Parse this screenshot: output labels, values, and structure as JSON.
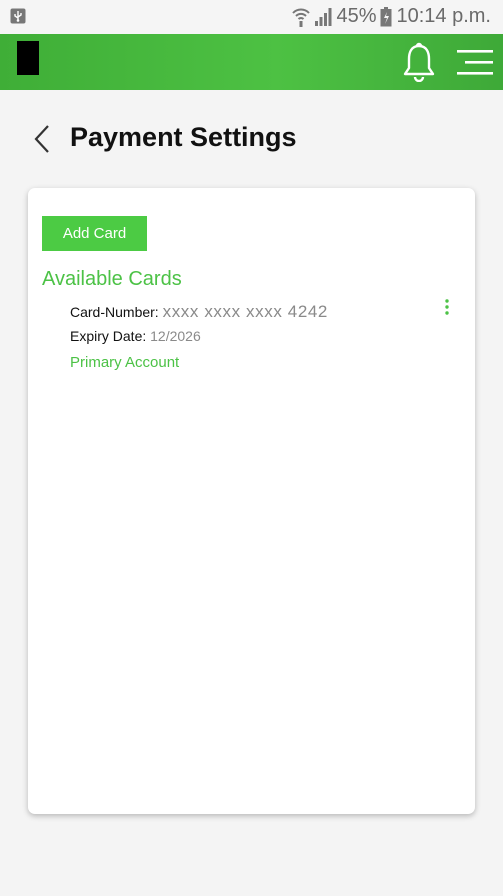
{
  "status_bar": {
    "battery": "45%",
    "time": "10:14 p.m.",
    "icons": [
      "usb-icon",
      "wifi-icon",
      "signal-icon",
      "battery-icon"
    ]
  },
  "header": {
    "icons": [
      "bell-icon",
      "menu-icon"
    ],
    "color": "#46b83e"
  },
  "page": {
    "title": "Payment Settings",
    "back_icon": "chevron-left-icon"
  },
  "cards_panel": {
    "add_card_label": "Add Card",
    "section_title": "Available Cards",
    "accent": "#4cc246",
    "cards": [
      {
        "number_label": "Card-Number:",
        "number_value": "xxxx xxxx xxxx 4242",
        "expiry_label": "Expiry Date:",
        "expiry_value": "12/2026",
        "tag": "Primary Account"
      }
    ]
  }
}
